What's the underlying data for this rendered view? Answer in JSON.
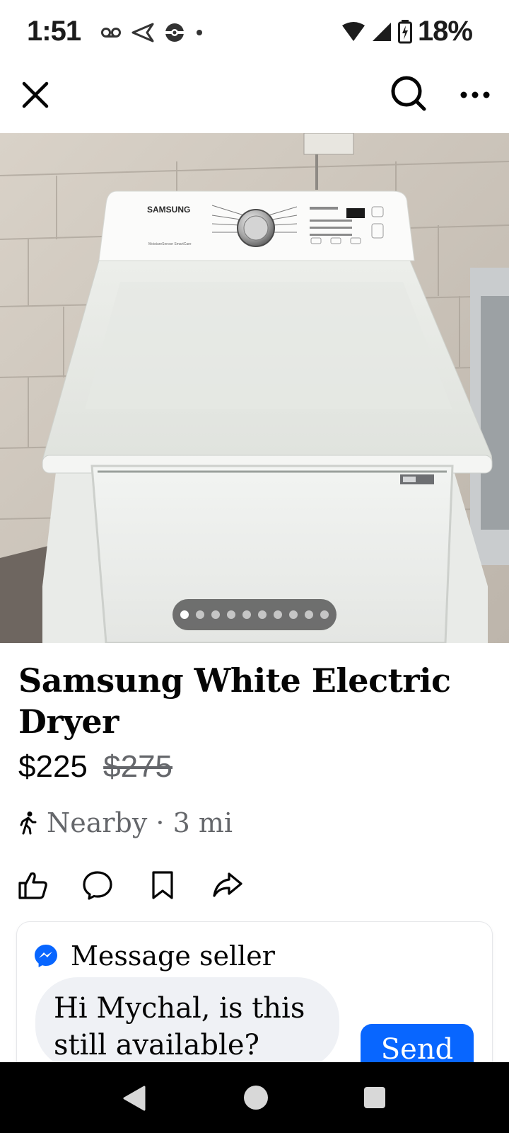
{
  "status_bar": {
    "time": "1:51",
    "battery": "18%"
  },
  "icons": {
    "close": "close-icon",
    "search": "search-icon",
    "more": "more-icon",
    "like": "thumbs-up-icon",
    "comment": "comment-icon",
    "save": "bookmark-icon",
    "share": "share-icon",
    "messenger": "messenger-icon",
    "walking": "walking-person-icon"
  },
  "photo": {
    "total_photos": 10,
    "current_index": 1,
    "brand_text": "SAMSUNG"
  },
  "listing": {
    "title": "Samsung White Electric Dryer",
    "price": "$225",
    "original_price": "$275",
    "location": "Nearby · 3 mi"
  },
  "message_card": {
    "title": "Message seller",
    "message_text": "Hi Mychal, is this still available?",
    "send_label": "Send"
  },
  "colors": {
    "accent": "#0866ff",
    "text_primary": "#050505",
    "text_secondary": "#65676b",
    "input_bg": "#eff1f5"
  }
}
